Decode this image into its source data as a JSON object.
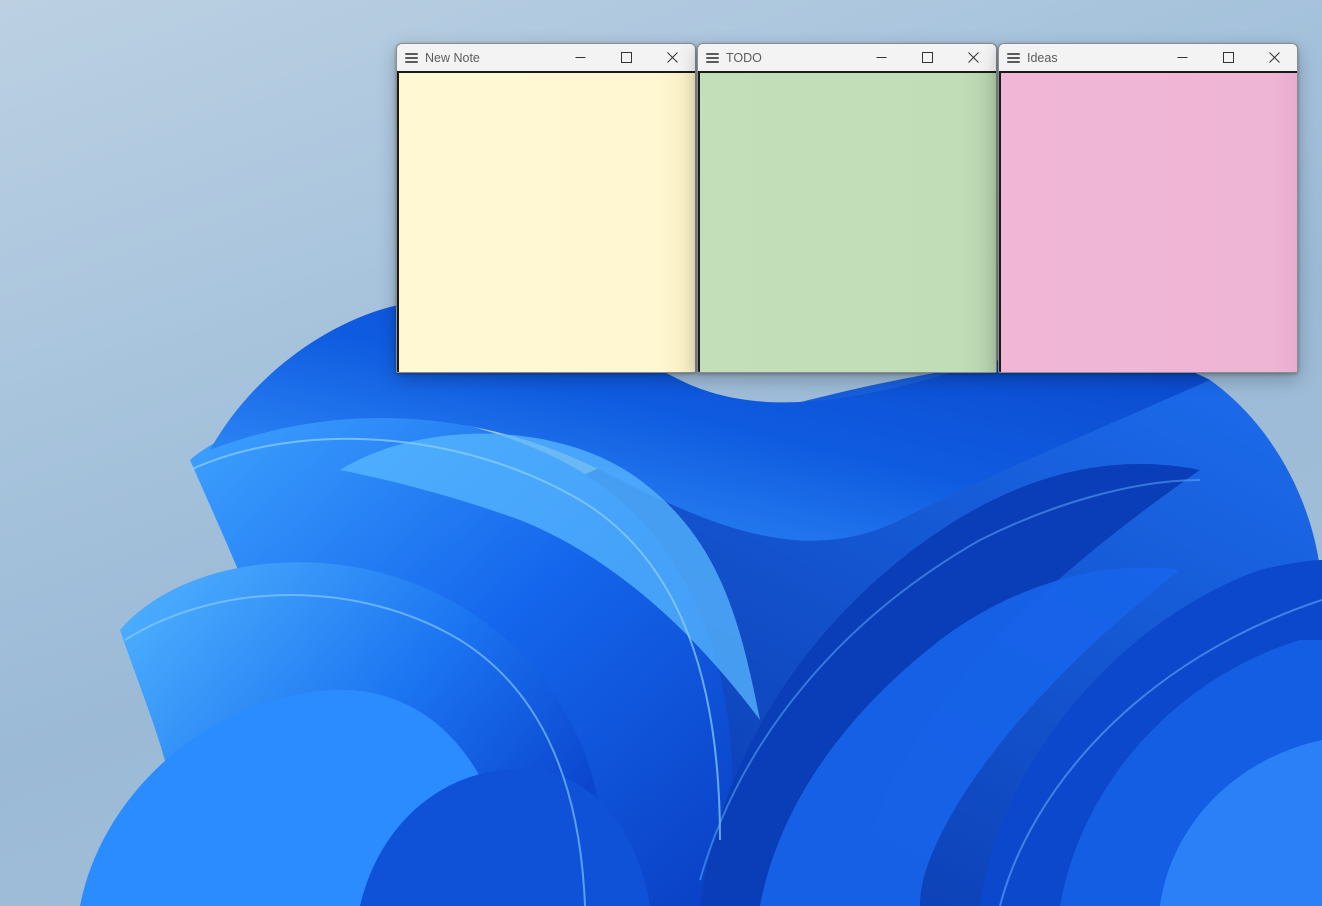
{
  "desktop": {
    "wallpaper": "Windows bloom wallpaper",
    "background_color": "#a9c3da",
    "accent_color": "#1a5be8"
  },
  "notes": [
    {
      "title": "New Note",
      "body_text": "",
      "color": "#fff7d1",
      "menu_icon": "hamburger-icon",
      "controls": [
        "minimize-icon",
        "maximize-icon",
        "close-icon"
      ]
    },
    {
      "title": "TODO",
      "body_text": "",
      "color": "#c1ddb8",
      "menu_icon": "hamburger-icon",
      "controls": [
        "minimize-icon",
        "maximize-icon",
        "close-icon"
      ]
    },
    {
      "title": "Ideas",
      "body_text": "",
      "color": "#efb5d5",
      "menu_icon": "hamburger-icon",
      "controls": [
        "minimize-icon",
        "maximize-icon",
        "close-icon"
      ]
    }
  ]
}
